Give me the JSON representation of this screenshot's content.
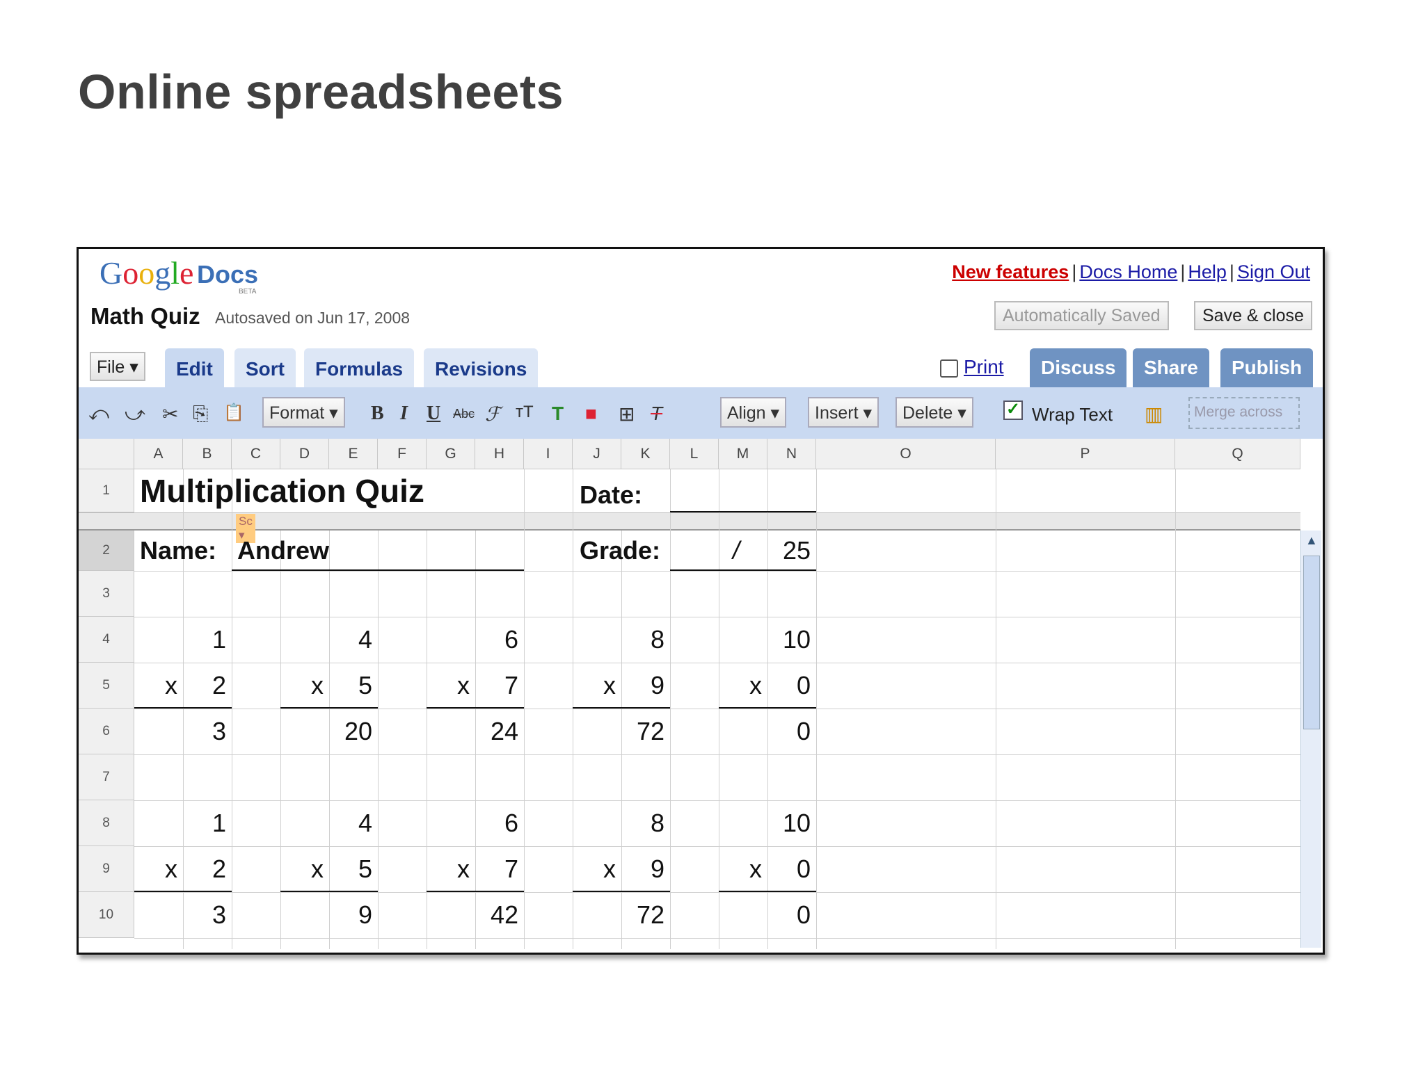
{
  "slide": {
    "title": "Online spreadsheets"
  },
  "app": {
    "logo_google": "Google",
    "logo_docs": "Docs",
    "logo_beta": "BETA",
    "doc_title": "Math Quiz",
    "autosave": "Autosaved on Jun 17, 2008"
  },
  "links": {
    "new_features": "New features",
    "docs_home": "Docs Home",
    "help": "Help",
    "sign_out": "Sign Out",
    "sep": "|"
  },
  "buttons": {
    "auto_saved": "Automatically Saved",
    "save_close": "Save & close",
    "print": "Print",
    "discuss": "Discuss",
    "share": "Share",
    "publish": "Publish"
  },
  "menu": {
    "file": "File ▾",
    "tabs": [
      "Edit",
      "Sort",
      "Formulas",
      "Revisions"
    ]
  },
  "toolbar": {
    "format": "Format ▾",
    "align": "Align ▾",
    "insert": "Insert ▾",
    "delete": "Delete ▾",
    "wrap_text": "Wrap Text",
    "wrap_checked": "✓",
    "merge_across": "Merge across",
    "icons": {
      "undo": "⤺",
      "redo": "⤻",
      "cut": "✂",
      "copy": "⎘",
      "paste": "📋",
      "bold": "B",
      "italic": "I",
      "underline": "U",
      "strike": "Abc",
      "font": "ℱ",
      "size": "тT",
      "text_color": "T",
      "bg_color": "■",
      "borders": "⊞",
      "clear": "T"
    }
  },
  "sheet": {
    "columns": [
      "A",
      "B",
      "C",
      "D",
      "E",
      "F",
      "G",
      "H",
      "I",
      "J",
      "K",
      "L",
      "M",
      "N",
      "O",
      "P",
      "Q"
    ],
    "rows": [
      "1",
      "2",
      "3",
      "4",
      "5",
      "6",
      "7",
      "8",
      "9",
      "10"
    ],
    "sc_tag": "Sc ▾",
    "title": "Multiplication Quiz",
    "date_label": "Date:",
    "name_label": "Name:",
    "name_value": "Andrew",
    "grade_label": "Grade:",
    "grade_slash": "/",
    "grade_total": "25",
    "times": "x",
    "block1": {
      "top": [
        "1",
        "4",
        "6",
        "8",
        "10"
      ],
      "bottom": [
        "2",
        "5",
        "7",
        "9",
        "0"
      ],
      "answers": [
        "3",
        "20",
        "24",
        "72",
        "0"
      ]
    },
    "block2": {
      "top": [
        "1",
        "4",
        "6",
        "8",
        "10"
      ],
      "bottom": [
        "2",
        "5",
        "7",
        "9",
        "0"
      ],
      "answers": [
        "3",
        "9",
        "42",
        "72",
        "0"
      ]
    }
  }
}
